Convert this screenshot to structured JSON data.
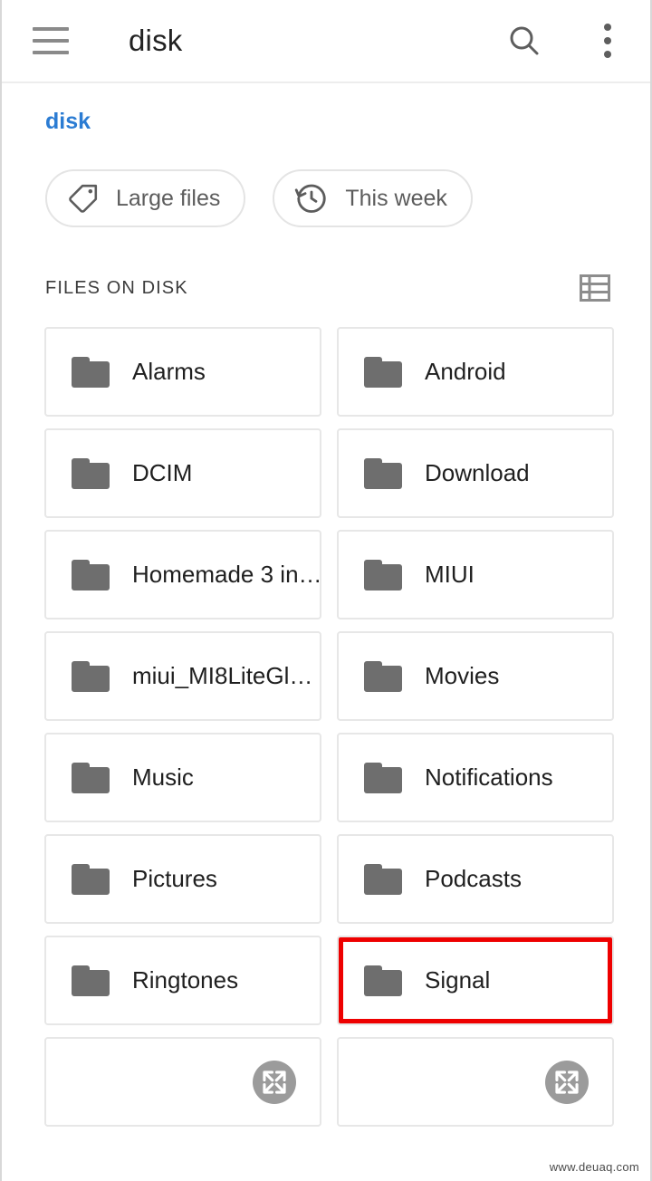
{
  "appbar": {
    "menu_icon": "hamburger-menu-icon",
    "title": "disk",
    "search_icon": "search-icon",
    "overflow_icon": "more-vertical-icon"
  },
  "breadcrumb": {
    "items": [
      "disk"
    ],
    "current": "disk",
    "link_color": "#2b7cd3"
  },
  "chips": [
    {
      "label": "Large files",
      "icon": "tag-icon"
    },
    {
      "label": "This week",
      "icon": "history-icon"
    }
  ],
  "section": {
    "title": "FILES ON DISK",
    "view_toggle_icon": "list-view-icon"
  },
  "files": {
    "items": [
      {
        "name": "Alarms",
        "icon": "folder-icon",
        "highlighted": false
      },
      {
        "name": "Android",
        "icon": "folder-icon",
        "highlighted": false
      },
      {
        "name": "DCIM",
        "icon": "folder-icon",
        "highlighted": false
      },
      {
        "name": "Download",
        "icon": "folder-icon",
        "highlighted": false
      },
      {
        "name": "Homemade 3 in…",
        "icon": "folder-icon",
        "highlighted": false
      },
      {
        "name": "MIUI",
        "icon": "folder-icon",
        "highlighted": false
      },
      {
        "name": "miui_MI8LiteGl…",
        "icon": "folder-icon",
        "highlighted": false
      },
      {
        "name": "Movies",
        "icon": "folder-icon",
        "highlighted": false
      },
      {
        "name": "Music",
        "icon": "folder-icon",
        "highlighted": false
      },
      {
        "name": "Notifications",
        "icon": "folder-icon",
        "highlighted": false
      },
      {
        "name": "Pictures",
        "icon": "folder-icon",
        "highlighted": false
      },
      {
        "name": "Podcasts",
        "icon": "folder-icon",
        "highlighted": false
      },
      {
        "name": "Ringtones",
        "icon": "folder-icon",
        "highlighted": false
      },
      {
        "name": "Signal",
        "icon": "folder-icon",
        "highlighted": true
      }
    ],
    "loading_placeholders": [
      {
        "icon": "expand-icon"
      },
      {
        "icon": "expand-icon"
      }
    ],
    "highlight_color": "#ee0000"
  },
  "watermark": "www.deuaq.com"
}
